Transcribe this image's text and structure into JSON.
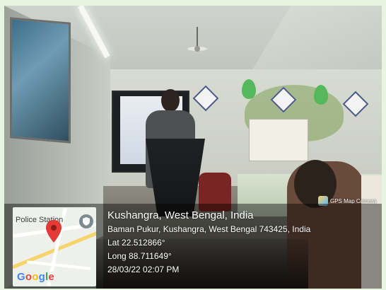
{
  "gps_badge": {
    "label": "GPS Map Camera",
    "icon": "gps-map-camera-icon"
  },
  "map": {
    "place_label": "Police Station",
    "logo": "Google",
    "pin_icon": "map-pin-icon",
    "poi_icon": "police-station-icon",
    "logo_colors": [
      "#4285F4",
      "#EA4335",
      "#FBBC05",
      "#4285F4",
      "#34A853",
      "#EA4335"
    ]
  },
  "location": {
    "title": "Kushangra, West Bengal, India",
    "address": "Baman Pukur, Kushangra, West Bengal 743425, India",
    "latitude": "Lat 22.512866°",
    "longitude": "Long 88.711649°",
    "timestamp": "28/03/22 02:07 PM"
  }
}
